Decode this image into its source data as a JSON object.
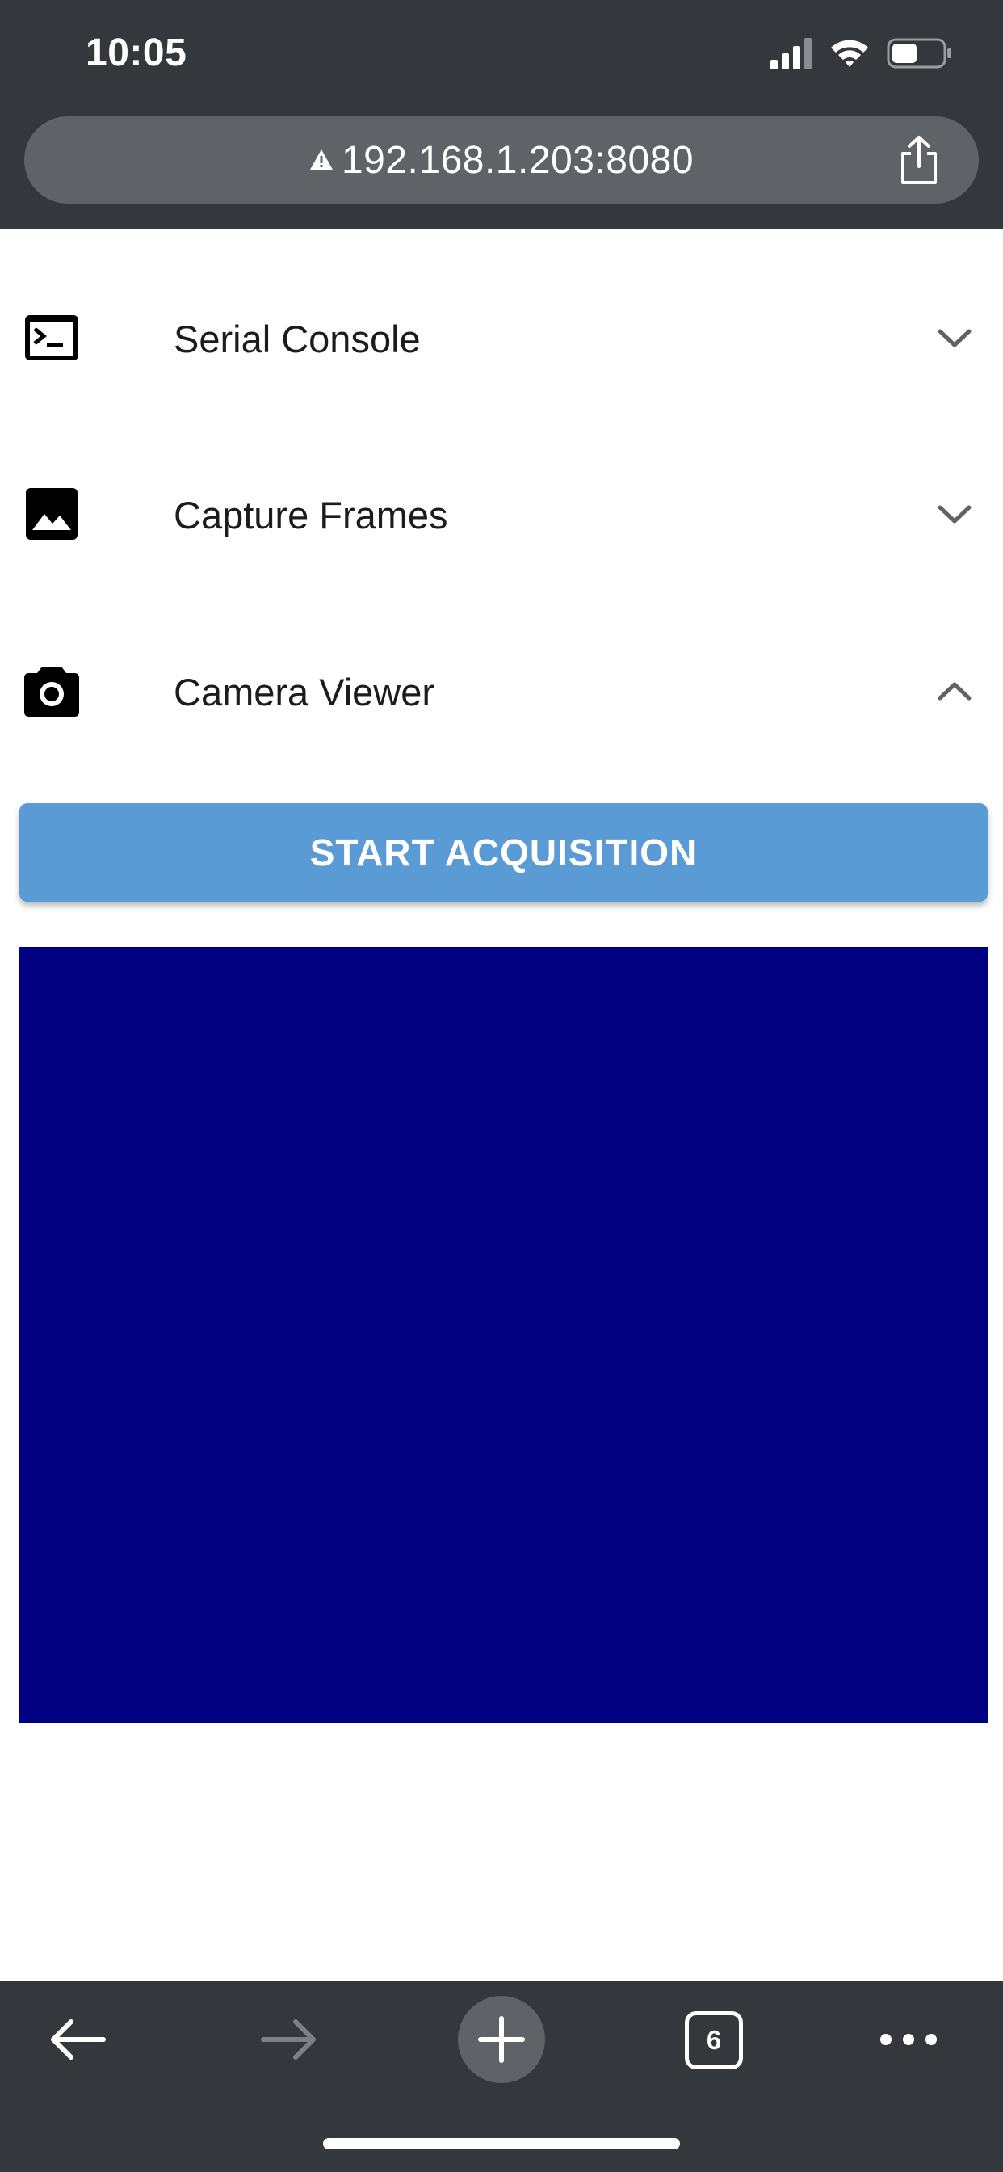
{
  "status_bar": {
    "time": "10:05",
    "icons": [
      "signal-icon",
      "wifi-icon",
      "battery-icon"
    ]
  },
  "address_bar": {
    "url": "192.168.1.203:8080",
    "security_icon": "warning-icon",
    "action_icon": "share-icon"
  },
  "sections": [
    {
      "label": "Serial Console",
      "icon": "terminal-icon",
      "expanded": false
    },
    {
      "label": "Capture Frames",
      "icon": "image-icon",
      "expanded": false
    },
    {
      "label": "Camera Viewer",
      "icon": "camera-icon",
      "expanded": true
    }
  ],
  "camera_viewer": {
    "button_label": "START ACQUISITION",
    "frame_color": "#000080"
  },
  "toolbar": {
    "tab_count": "6",
    "icons": [
      "back-arrow-icon",
      "forward-arrow-icon",
      "plus-icon",
      "tabs-icon",
      "more-icon"
    ]
  },
  "colors": {
    "chrome_background": "#34373b",
    "url_bar_background": "#5f6368",
    "button_blue": "#5b9bd5",
    "frame_blue": "#000080"
  }
}
